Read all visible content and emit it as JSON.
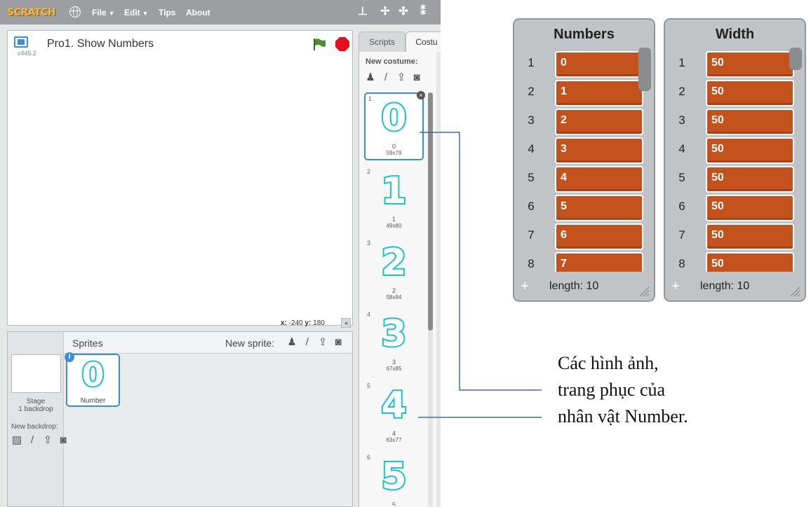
{
  "menubar": {
    "logo": "SCRATCH",
    "menus": [
      {
        "label": "File",
        "caret": "▼"
      },
      {
        "label": "Edit",
        "caret": "▼"
      },
      {
        "label": "Tips",
        "caret": ""
      },
      {
        "label": "About",
        "caret": ""
      }
    ],
    "tools": [
      "stamp-icon",
      "cut-icon",
      "grow-icon",
      "shrink-icon"
    ]
  },
  "stage": {
    "version": "v445.2",
    "project_title": "Pro1. Show Numbers",
    "coords": {
      "x_label": "x:",
      "x": "-240",
      "y_label": "y:",
      "y": "180"
    }
  },
  "sprites": {
    "label": "Sprites",
    "new_sprite_label": "New sprite:",
    "stage_name": "Stage",
    "backdrop_count": "1 backdrop",
    "new_backdrop_label": "New backdrop:",
    "selected_sprite": {
      "glyph": "0",
      "name": "Number"
    }
  },
  "tabs": {
    "scripts": "Scripts",
    "costumes": "Costu"
  },
  "costumes": {
    "new_costume_label": "New costume:",
    "items": [
      {
        "index": "1",
        "glyph": "0",
        "name": "0",
        "size": "59x79"
      },
      {
        "index": "2",
        "glyph": "1",
        "name": "1",
        "size": "49x80"
      },
      {
        "index": "3",
        "glyph": "2",
        "name": "2",
        "size": "58x84"
      },
      {
        "index": "4",
        "glyph": "3",
        "name": "3",
        "size": "67x85"
      },
      {
        "index": "5",
        "glyph": "4",
        "name": "4",
        "size": "63x77"
      },
      {
        "index": "6",
        "glyph": "5",
        "name": "5",
        "size": ""
      }
    ]
  },
  "lists": [
    {
      "title": "Numbers",
      "rows": [
        {
          "index": "1",
          "value": "0"
        },
        {
          "index": "2",
          "value": "1"
        },
        {
          "index": "3",
          "value": "2"
        },
        {
          "index": "4",
          "value": "3"
        },
        {
          "index": "5",
          "value": "4"
        },
        {
          "index": "6",
          "value": "5"
        },
        {
          "index": "7",
          "value": "6"
        },
        {
          "index": "8",
          "value": "7"
        }
      ],
      "length": "length: 10"
    },
    {
      "title": "Width",
      "rows": [
        {
          "index": "1",
          "value": "50"
        },
        {
          "index": "2",
          "value": "50"
        },
        {
          "index": "3",
          "value": "50"
        },
        {
          "index": "4",
          "value": "50"
        },
        {
          "index": "5",
          "value": "50"
        },
        {
          "index": "6",
          "value": "50"
        },
        {
          "index": "7",
          "value": "50"
        },
        {
          "index": "8",
          "value": "50"
        }
      ],
      "length": "length: 10"
    }
  ],
  "annotation": {
    "lines": [
      "Các hình ảnh,",
      "trang phục của",
      "nhân vật Number."
    ]
  },
  "colors": {
    "accent": "#3a8ed8",
    "list_item": "#c4521c",
    "costume_stroke": "#19c3c9",
    "menubar": "#9c9ea2"
  }
}
